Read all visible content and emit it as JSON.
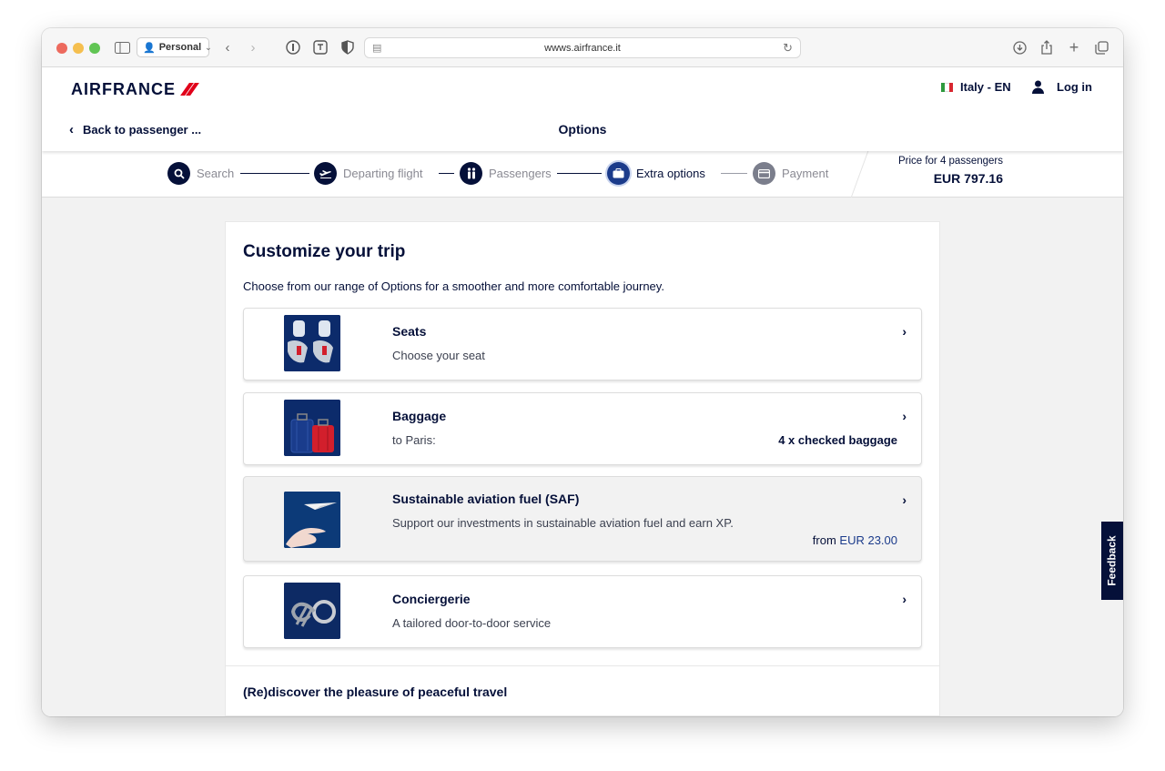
{
  "browser": {
    "profile_label": "Personal",
    "url": "wwws.airfrance.it"
  },
  "header": {
    "logo_text": "AIRFRANCE",
    "language": "Italy - EN",
    "login_label": "Log in",
    "back_label": "Back to passenger ...",
    "page_title": "Options"
  },
  "stepper": {
    "steps": [
      {
        "label": "Search",
        "icon": "search-icon",
        "state": "done"
      },
      {
        "label": "Departing flight",
        "icon": "plane-icon",
        "state": "done"
      },
      {
        "label": "Passengers",
        "icon": "passengers-icon",
        "state": "done"
      },
      {
        "label": "Extra options",
        "icon": "suitcase-icon",
        "state": "active"
      },
      {
        "label": "Payment",
        "icon": "card-icon",
        "state": "pending"
      }
    ],
    "price_label": "Price for 4 passengers",
    "price_value": "EUR 797.16"
  },
  "main": {
    "title": "Customize your trip",
    "intro": "Choose from our range of Options for a smoother and more comfortable journey.",
    "options": [
      {
        "title": "Seats",
        "subtitle": "Choose your seat",
        "icon": "seats-image"
      },
      {
        "title": "Baggage",
        "subtitle": "to Paris:",
        "detail": "4 x checked baggage",
        "icon": "baggage-image"
      },
      {
        "title": "Sustainable aviation fuel (SAF)",
        "subtitle": "Support our investments in sustainable aviation fuel and earn XP.",
        "price_prefix": "from",
        "price": "EUR 23.00",
        "icon": "saf-image"
      },
      {
        "title": "Conciergerie",
        "subtitle": "A tailored door-to-door service",
        "icon": "conciergerie-image"
      }
    ],
    "section2_title": "(Re)discover the pleasure of peaceful travel"
  },
  "feedback_label": "Feedback",
  "colors": {
    "brand_navy": "#051039",
    "accent_blue": "#1b3b8b",
    "brand_red": "#e1001a"
  }
}
